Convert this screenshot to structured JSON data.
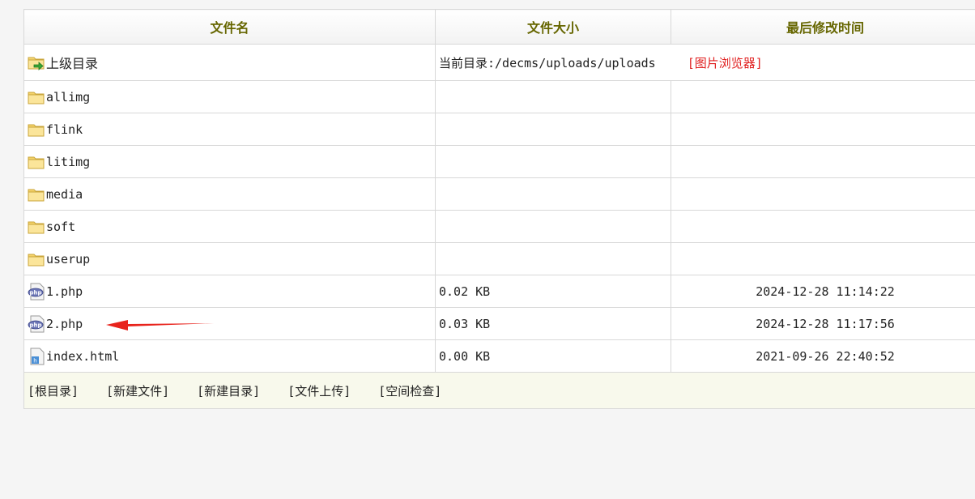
{
  "headers": {
    "name": "文件名",
    "size": "文件大小",
    "mtime": "最后修改时间"
  },
  "parent": {
    "label": "上级目录",
    "current_dir": "当前目录:/decms/uploads/uploads",
    "viewer_link": "[图片浏览器]"
  },
  "rows": [
    {
      "type": "folder",
      "name": "allimg",
      "size": "",
      "mtime": ""
    },
    {
      "type": "folder",
      "name": "flink",
      "size": "",
      "mtime": ""
    },
    {
      "type": "folder",
      "name": "litimg",
      "size": "",
      "mtime": ""
    },
    {
      "type": "folder",
      "name": "media",
      "size": "",
      "mtime": ""
    },
    {
      "type": "folder",
      "name": "soft",
      "size": "",
      "mtime": ""
    },
    {
      "type": "folder",
      "name": "userup",
      "size": "",
      "mtime": ""
    },
    {
      "type": "php",
      "name": "1.php",
      "size": "0.02 KB",
      "mtime": "2024-12-28 11:14:22"
    },
    {
      "type": "php",
      "name": "2.php",
      "size": "0.03 KB",
      "mtime": "2024-12-28 11:17:56"
    },
    {
      "type": "html",
      "name": "index.html",
      "size": "0.00 KB",
      "mtime": "2021-09-26 22:40:52"
    }
  ],
  "footer_links": [
    "[根目录]",
    "[新建文件]",
    "[新建目录]",
    "[文件上传]",
    "[空间检查]"
  ],
  "colors": {
    "header_text": "#666600",
    "link_red": "#e02020",
    "footer_bg": "#f8f9ec",
    "arrow": "#e8231c"
  }
}
